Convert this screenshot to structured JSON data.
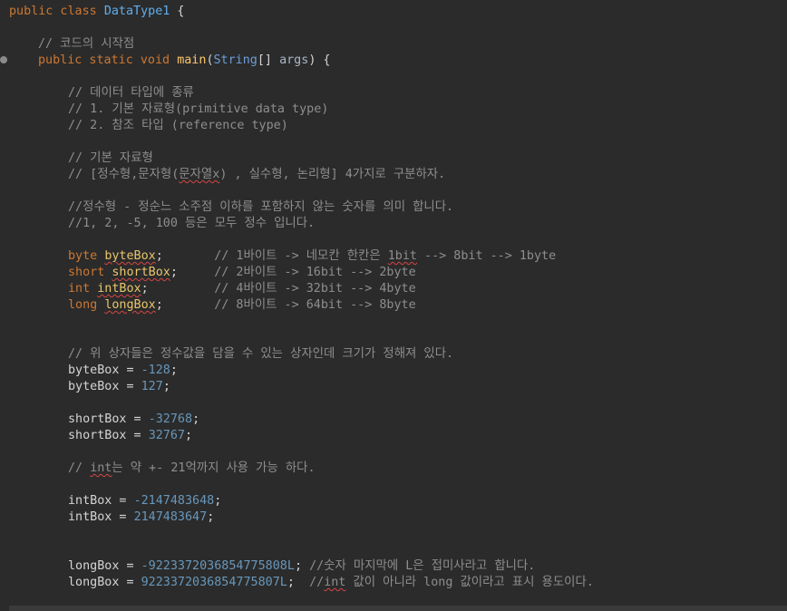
{
  "editor": {
    "lines": [
      {
        "row": 0,
        "indent": 10,
        "tokens": [
          {
            "t": "public class ",
            "c": "kw"
          },
          {
            "t": "DataType1",
            "c": "cls"
          },
          {
            "t": " {",
            "c": "plain"
          }
        ]
      },
      {
        "row": 2,
        "indent": 42,
        "tokens": [
          {
            "t": "// 코드의 시작점",
            "c": "com"
          }
        ]
      },
      {
        "row": 3,
        "indent": 42,
        "tokens": [
          {
            "t": "public static void ",
            "c": "kw"
          },
          {
            "t": "main",
            "c": "meth"
          },
          {
            "t": "(",
            "c": "plain"
          },
          {
            "t": "String",
            "c": "type"
          },
          {
            "t": "[] ",
            "c": "plain"
          },
          {
            "t": "args",
            "c": "param"
          },
          {
            "t": ") {",
            "c": "plain"
          }
        ]
      },
      {
        "row": 5,
        "indent": 75,
        "tokens": [
          {
            "t": "// 데이터 타입에 종류",
            "c": "com"
          }
        ]
      },
      {
        "row": 6,
        "indent": 75,
        "tokens": [
          {
            "t": "// 1. 기본 자료형(primitive data type)",
            "c": "com"
          }
        ]
      },
      {
        "row": 7,
        "indent": 75,
        "tokens": [
          {
            "t": "// 2. 참조 타입 (reference type)",
            "c": "com"
          }
        ]
      },
      {
        "row": 9,
        "indent": 75,
        "tokens": [
          {
            "t": "// 기본 자료형",
            "c": "com"
          }
        ]
      },
      {
        "row": 10,
        "indent": 75,
        "tokens": [
          {
            "t": "// [정수형,문자형(",
            "c": "com"
          },
          {
            "t": "문자열x",
            "c": "com",
            "sq": true
          },
          {
            "t": ") , 실수형, 논리형] 4가지로 구분하자.",
            "c": "com"
          }
        ]
      },
      {
        "row": 12,
        "indent": 75,
        "tokens": [
          {
            "t": "//정수형 - 정순느 소주점 이하를 포함하지 않는 숫자를 의미 합니다.",
            "c": "com"
          }
        ]
      },
      {
        "row": 13,
        "indent": 75,
        "tokens": [
          {
            "t": "//1, 2, -5, 100 등은 모두 정수 입니다.",
            "c": "com"
          }
        ]
      },
      {
        "row": 15,
        "indent": 75,
        "tokens": [
          {
            "t": "byte ",
            "c": "kw"
          },
          {
            "t": "byteBox",
            "c": "var",
            "sq": true
          },
          {
            "t": ";       ",
            "c": "plain"
          },
          {
            "t": "// 1바이트 -> 네모칸 한칸은 ",
            "c": "com"
          },
          {
            "t": "1bit",
            "c": "com",
            "sq": true
          },
          {
            "t": " --> 8bit --> 1byte",
            "c": "com"
          }
        ]
      },
      {
        "row": 16,
        "indent": 75,
        "tokens": [
          {
            "t": "short ",
            "c": "kw"
          },
          {
            "t": "shortBox",
            "c": "var",
            "sq": true
          },
          {
            "t": ";     ",
            "c": "plain"
          },
          {
            "t": "// 2바이트 -> 16bit --> 2byte",
            "c": "com"
          }
        ]
      },
      {
        "row": 17,
        "indent": 75,
        "tokens": [
          {
            "t": "int ",
            "c": "kw"
          },
          {
            "t": "intBox",
            "c": "var",
            "sq": true
          },
          {
            "t": ";         ",
            "c": "plain"
          },
          {
            "t": "// 4바이트 -> 32bit --> 4byte",
            "c": "com"
          }
        ]
      },
      {
        "row": 18,
        "indent": 75,
        "tokens": [
          {
            "t": "long ",
            "c": "kw"
          },
          {
            "t": "longBox",
            "c": "var",
            "sq": true
          },
          {
            "t": ";       ",
            "c": "plain"
          },
          {
            "t": "// 8바이트 -> 64bit --> 8byte",
            "c": "com"
          }
        ]
      },
      {
        "row": 21,
        "indent": 75,
        "tokens": [
          {
            "t": "// 위 상자들은 정수값을 담을 수 있는 상자인데 크기가 정해져 있다.",
            "c": "com"
          }
        ]
      },
      {
        "row": 22,
        "indent": 75,
        "tokens": [
          {
            "t": "byteBox",
            "c": "plain"
          },
          {
            "t": " = ",
            "c": "plain"
          },
          {
            "t": "-128",
            "c": "num"
          },
          {
            "t": ";",
            "c": "plain"
          }
        ]
      },
      {
        "row": 23,
        "indent": 75,
        "tokens": [
          {
            "t": "byteBox",
            "c": "plain"
          },
          {
            "t": " = ",
            "c": "plain"
          },
          {
            "t": "127",
            "c": "num"
          },
          {
            "t": ";",
            "c": "plain"
          }
        ]
      },
      {
        "row": 25,
        "indent": 75,
        "tokens": [
          {
            "t": "shortBox",
            "c": "plain"
          },
          {
            "t": " = ",
            "c": "plain"
          },
          {
            "t": "-32768",
            "c": "num"
          },
          {
            "t": ";",
            "c": "plain"
          }
        ]
      },
      {
        "row": 26,
        "indent": 75,
        "tokens": [
          {
            "t": "shortBox",
            "c": "plain"
          },
          {
            "t": " = ",
            "c": "plain"
          },
          {
            "t": "32767",
            "c": "num"
          },
          {
            "t": ";",
            "c": "plain"
          }
        ]
      },
      {
        "row": 28,
        "indent": 75,
        "tokens": [
          {
            "t": "// ",
            "c": "com"
          },
          {
            "t": "int",
            "c": "com",
            "sq": true
          },
          {
            "t": "는 약 +- 21억까지 사용 가능 하다.",
            "c": "com"
          }
        ]
      },
      {
        "row": 30,
        "indent": 75,
        "tokens": [
          {
            "t": "intBox",
            "c": "plain"
          },
          {
            "t": " = ",
            "c": "plain"
          },
          {
            "t": "-2147483648",
            "c": "num"
          },
          {
            "t": ";",
            "c": "plain"
          }
        ]
      },
      {
        "row": 31,
        "indent": 75,
        "tokens": [
          {
            "t": "intBox",
            "c": "plain"
          },
          {
            "t": " = ",
            "c": "plain"
          },
          {
            "t": "2147483647",
            "c": "num"
          },
          {
            "t": ";",
            "c": "plain"
          }
        ]
      },
      {
        "row": 34,
        "indent": 75,
        "tokens": [
          {
            "t": "longBox",
            "c": "plain"
          },
          {
            "t": " = ",
            "c": "plain"
          },
          {
            "t": "-9223372036854775808L",
            "c": "num"
          },
          {
            "t": "; ",
            "c": "plain"
          },
          {
            "t": "//숫자 마지막에 L은 접미사라고 합니다.",
            "c": "com"
          }
        ]
      },
      {
        "row": 35,
        "indent": 75,
        "tokens": [
          {
            "t": "longBox",
            "c": "plain"
          },
          {
            "t": " = ",
            "c": "plain"
          },
          {
            "t": "9223372036854775807L",
            "c": "num"
          },
          {
            "t": ";  ",
            "c": "plain"
          },
          {
            "t": "//",
            "c": "com"
          },
          {
            "t": "int",
            "c": "com",
            "sq": true
          },
          {
            "t": " 값이 아니라 long 값이라고 표시 용도이다.",
            "c": "com"
          }
        ]
      }
    ]
  },
  "colors": {
    "background": "#2b2b2b",
    "keyword": "#cc7832",
    "class_name": "#61aeee",
    "method": "#ffc66d",
    "number": "#6897bb",
    "comment": "#8e8e8e"
  }
}
